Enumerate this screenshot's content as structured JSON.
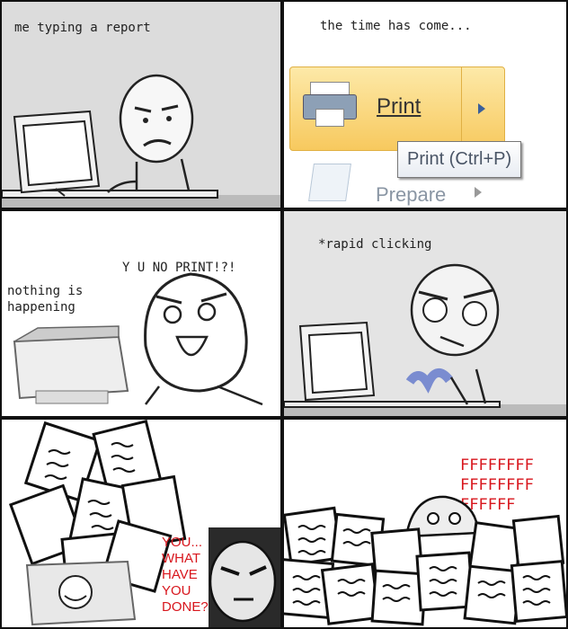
{
  "panels": {
    "p1": {
      "caption": "me typing a report"
    },
    "p2": {
      "caption": "the time has come...",
      "menu_print": "Print",
      "menu_prepare": "Prepare",
      "tooltip": "Print (Ctrl+P)"
    },
    "p3": {
      "caption_left": "nothing is\nhappening",
      "caption_shout": "Y U NO PRINT!?!"
    },
    "p4": {
      "caption": "*rapid clicking"
    },
    "p5": {
      "caption": "YOU...\nWHAT\nHAVE\nYOU\nDONE?"
    },
    "p6": {
      "caption": "FFFFFFFF\nFFFFFFFF\nFFFFFF"
    }
  },
  "colors": {
    "menu_highlight": "#fbd77a",
    "text_red": "#d8161d",
    "border": "#111111"
  }
}
